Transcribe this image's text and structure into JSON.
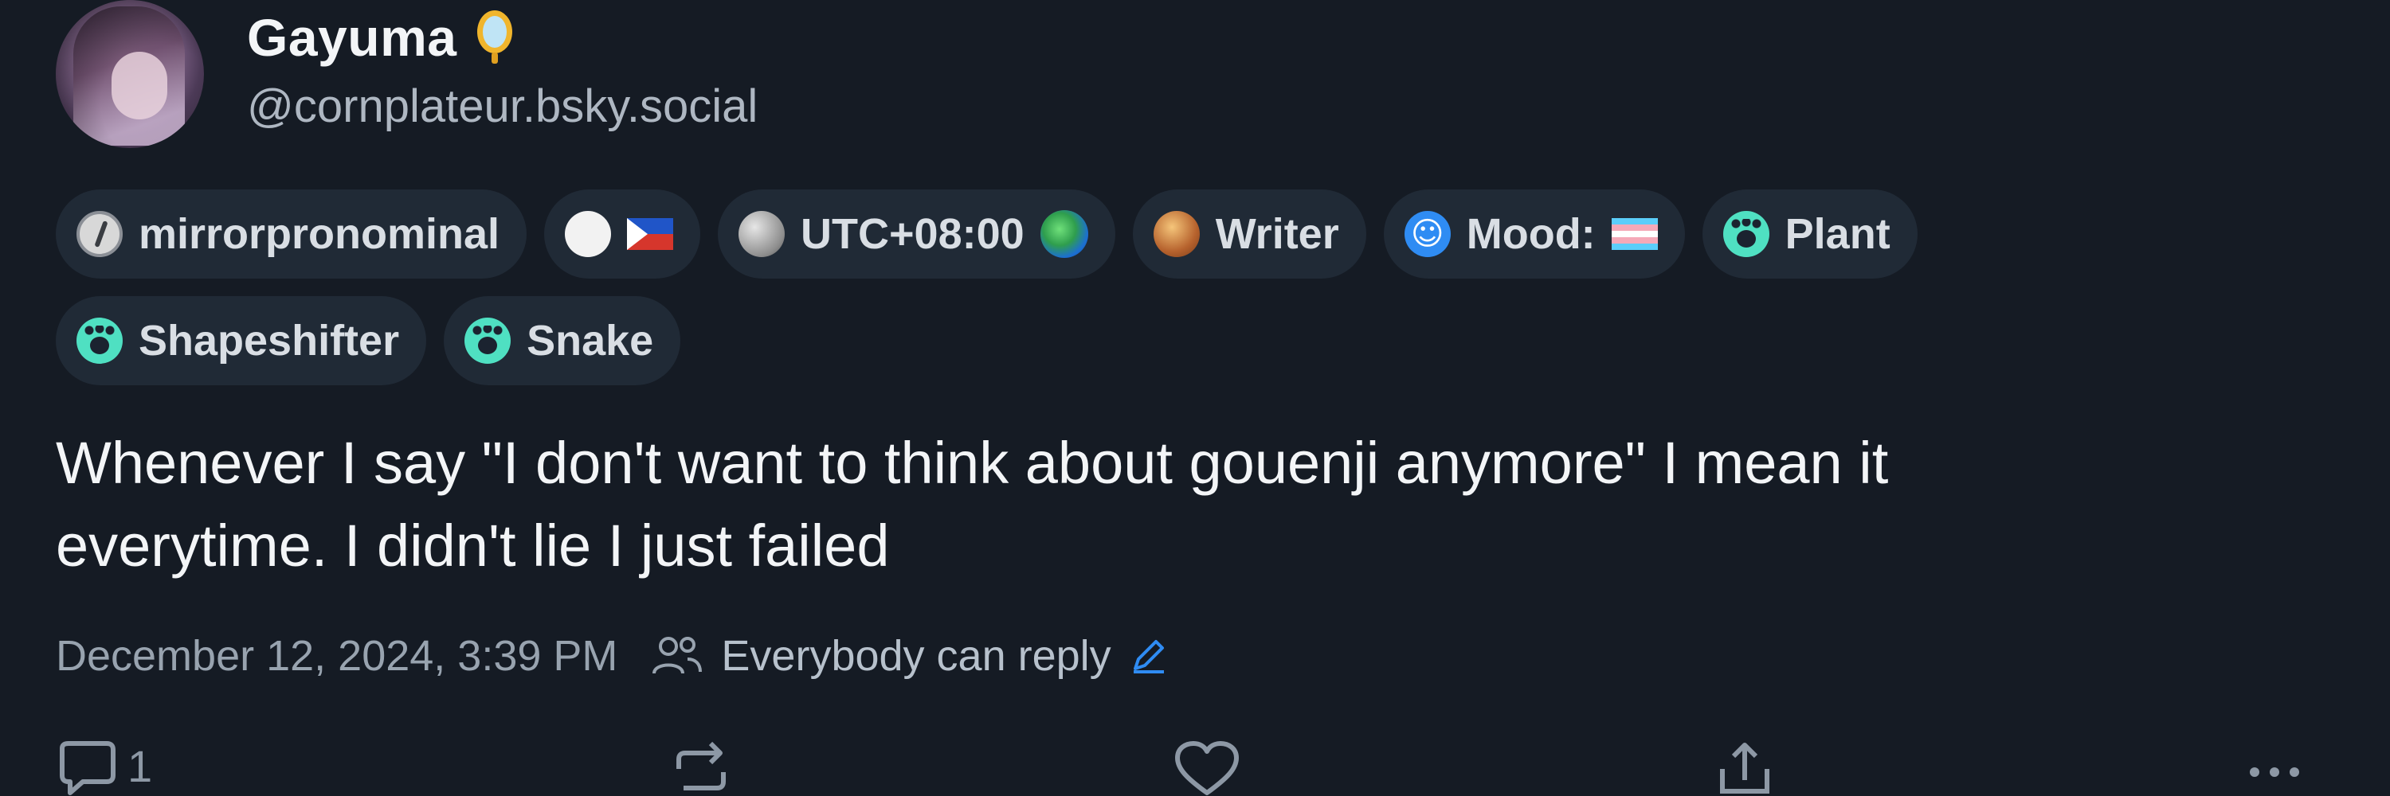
{
  "post": {
    "author": {
      "display_name": "Gayuma",
      "handle": "@cornplateur.bsky.social",
      "badge_icon": "mirror-icon"
    },
    "tags": [
      {
        "icon": "slash-circle-icon",
        "label": "mirrorpronominal"
      },
      {
        "icon": "white-blob-icon",
        "flag": "philippines-flag-icon",
        "label": ""
      },
      {
        "icon": "moon-icon",
        "label": "UTC+08:00",
        "trailing": "globe-icon"
      },
      {
        "icon": "mushroom-icon",
        "label": "Writer"
      },
      {
        "icon": "smile-icon",
        "label": "Mood:",
        "flag": "trans-flag-icon"
      },
      {
        "icon": "paw-icon",
        "label": "Plant"
      },
      {
        "icon": "paw-icon",
        "label": "Shapeshifter"
      },
      {
        "icon": "paw-icon",
        "label": "Snake"
      }
    ],
    "text_line1": "Whenever I say \"I don't want to think about gouenji anymore\" I mean it",
    "text_line2": "everytime. I didn't lie I just failed",
    "timestamp": "December 12, 2024, 3:39 PM",
    "reply_setting": "Everybody can reply",
    "counts": {
      "replies": "1"
    }
  },
  "colors": {
    "background": "#151b24",
    "tag_bg": "#202a36",
    "accent_blue": "#2f8cf3",
    "paw_teal": "#4fe0c2",
    "muted_text": "#98a3af"
  }
}
